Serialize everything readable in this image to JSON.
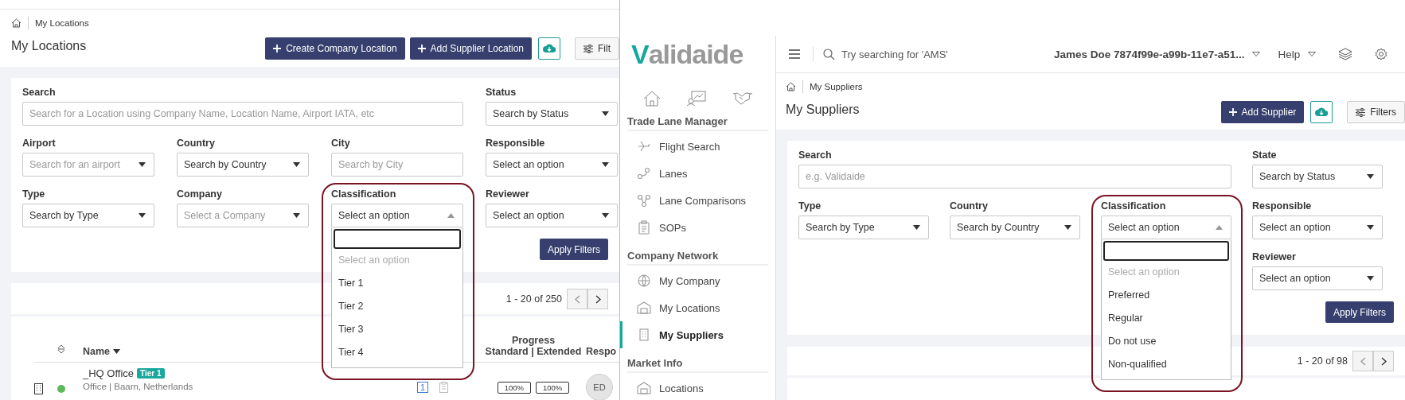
{
  "left_panel": {
    "breadcrumb": "My Locations",
    "title": "My Locations",
    "actions": [
      {
        "kind": "primary",
        "label": "Create Company Location"
      },
      {
        "kind": "primary",
        "label": "Add Supplier Location"
      },
      {
        "kind": "download"
      },
      {
        "kind": "filters",
        "label": "Filt"
      }
    ],
    "filters": {
      "rows": [
        [
          {
            "kind": "text",
            "label": "Search",
            "placeholder": "Search for a Location using Company Name, Location Name, Airport IATA, etc",
            "highlighted": false
          },
          "",
          "",
          {
            "kind": "select",
            "label": "Status",
            "value": "Search by Status",
            "expanded": false,
            "highlighted": false
          }
        ],
        [
          {
            "kind": "select",
            "label": "Airport",
            "placeholder": "Search for an airport",
            "expanded": false,
            "highlighted": false
          },
          {
            "kind": "select",
            "label": "Country",
            "value": "Search by Country",
            "expanded": false,
            "highlighted": false
          },
          {
            "kind": "text",
            "label": "City",
            "placeholder": "Search by City",
            "highlighted": false
          },
          {
            "kind": "select",
            "label": "Responsible",
            "value": "Select an option",
            "expanded": false,
            "highlighted": false
          }
        ],
        [
          {
            "kind": "select",
            "label": "Type",
            "value": "Search by Type",
            "expanded": false,
            "highlighted": false
          },
          {
            "kind": "select",
            "label": "Company",
            "placeholder": "Select a Company",
            "expanded": false,
            "highlighted": false
          },
          {
            "kind": "select",
            "label": "Classification",
            "value": "Select an option",
            "expanded": true,
            "highlighted": true,
            "options": [
              {
                "kind": "placeholder",
                "label": "Select an option"
              },
              {
                "kind": "option",
                "label": "Tier 1"
              },
              {
                "kind": "option",
                "label": "Tier 2"
              },
              {
                "kind": "option",
                "label": "Tier 3"
              },
              {
                "kind": "option",
                "label": "Tier 4"
              }
            ]
          },
          {
            "kind": "select",
            "label": "Reviewer",
            "value": "Select an option",
            "expanded": false,
            "highlighted": false
          }
        ]
      ],
      "apply": "Apply Filters"
    },
    "pagination": "1 - 20 of 250",
    "table": {
      "columns": [
        {
          "kind": "sort-toggle"
        },
        {
          "kind": "sortable",
          "label": "Name"
        },
        {
          "kind": "progress",
          "label": "Progress",
          "sublabel": "Standard | Extended"
        },
        {
          "kind": "plain",
          "label": "Respo"
        }
      ],
      "rows": [
        {
          "name": "_HQ Office",
          "badge": "Tier 1",
          "subtitle": "Office | Baarn, Netherlands",
          "color": "#5cb85c",
          "count": "1",
          "progress": [
            "100%",
            "100%"
          ],
          "avatar": "ED"
        }
      ]
    }
  },
  "right_panel": {
    "logo": "Validaide",
    "topbar": {
      "search_placeholder": "Try searching for 'AMS'",
      "user": "James Doe 7874f99e-a99b-11e7-a51...",
      "help": "Help"
    },
    "sidebar": {
      "sections": [
        {
          "title": "Trade Lane Manager",
          "items": [
            {
              "label": "Flight Search",
              "selected": false
            },
            {
              "label": "Lanes",
              "selected": false
            },
            {
              "label": "Lane Comparisons",
              "selected": false
            },
            {
              "label": "SOPs",
              "selected": false
            }
          ]
        },
        {
          "title": "Company Network",
          "items": [
            {
              "label": "My Company",
              "selected": false
            },
            {
              "label": "My Locations",
              "selected": false
            },
            {
              "label": "My Suppliers",
              "selected": true
            }
          ]
        },
        {
          "title": "Market Info",
          "items": [
            {
              "label": "Locations",
              "selected": false
            }
          ]
        }
      ]
    },
    "breadcrumb": "My Suppliers",
    "title": "My Suppliers",
    "actions": [
      {
        "kind": "primary",
        "label": "Add Supplier"
      },
      {
        "kind": "download"
      },
      {
        "kind": "filters",
        "label": "Filters"
      }
    ],
    "filters": {
      "rows": [
        [
          {
            "kind": "text",
            "label": "Search",
            "placeholder": "e.g. Validaide",
            "highlighted": false
          },
          "",
          "",
          {
            "kind": "select",
            "label": "State",
            "value": "Search by Status",
            "expanded": false,
            "highlighted": false
          }
        ],
        [
          {
            "kind": "select",
            "label": "Type",
            "value": "Search by Type",
            "expanded": false,
            "highlighted": false
          },
          {
            "kind": "select",
            "label": "Country",
            "value": "Search by Country",
            "expanded": false,
            "highlighted": false
          },
          {
            "kind": "select",
            "label": "Classification",
            "value": "Select an option",
            "expanded": true,
            "highlighted": true,
            "options": [
              {
                "kind": "placeholder",
                "label": "Select an option"
              },
              {
                "kind": "option",
                "label": "Preferred"
              },
              {
                "kind": "option",
                "label": "Regular"
              },
              {
                "kind": "option",
                "label": "Do not use"
              },
              {
                "kind": "option",
                "label": "Non-qualified"
              }
            ]
          },
          {
            "kind": "select",
            "label": "Responsible",
            "value": "Select an option",
            "expanded": false,
            "highlighted": false
          }
        ],
        [
          "",
          "",
          "",
          {
            "kind": "select",
            "label": "Reviewer",
            "value": "Select an option",
            "expanded": false,
            "highlighted": false
          }
        ]
      ],
      "apply": "Apply Filters"
    },
    "pagination": "1 - 20 of 98"
  }
}
